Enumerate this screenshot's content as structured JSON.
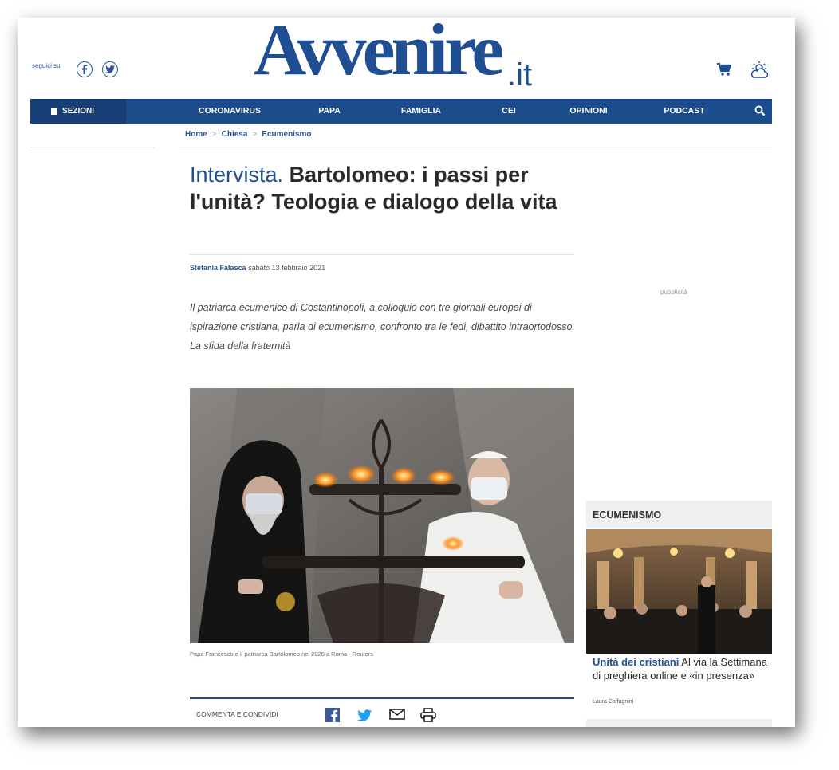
{
  "header": {
    "follow_label": "seguici su",
    "logo_main": "Avvenire",
    "logo_suffix": ".it"
  },
  "nav": {
    "sections_label": "SEZIONI",
    "items": [
      "CORONAVIRUS",
      "PAPA",
      "FAMIGLIA",
      "CEI",
      "OPINIONI",
      "PODCAST"
    ]
  },
  "breadcrumb": [
    "Home",
    "Chiesa",
    "Ecumenismo"
  ],
  "article": {
    "kicker": "Intervista.",
    "title": "Bartolomeo: i passi per l'unità? Teologia e dialogo della vita",
    "author": "Stefania Falasca",
    "date": "sabato 13 febbraio 2021",
    "summary": "Il patriarca ecumenico di Costantinopoli, a colloquio con tre giornali europei di ispirazione cristiana, parla di ecumenismo, confronto tra le fedi, dibattito intraortodosso. La sfida della fraternità",
    "caption": "Papa Francesco e il patriarca Bartolomeo nel 2020 a Roma - Reuters",
    "share_label": "COMMENTA E CONDIVIDI"
  },
  "sidebar": {
    "ad_label": "pubblicità",
    "section_title": "ECUMENISMO",
    "story_kicker": "Unità dei cristiani",
    "story_title": "Al via la Settimana di preghiera online e «in presenza»",
    "story_author": "Laura Caffagnini"
  },
  "colors": {
    "brand_blue": "#1f4e93",
    "nav_bg": "#1b4d8c",
    "nav_dark": "#173f76"
  },
  "icons": [
    "facebook-icon",
    "twitter-icon",
    "cart-icon",
    "weather-icon",
    "search-icon",
    "mail-icon",
    "print-icon"
  ]
}
